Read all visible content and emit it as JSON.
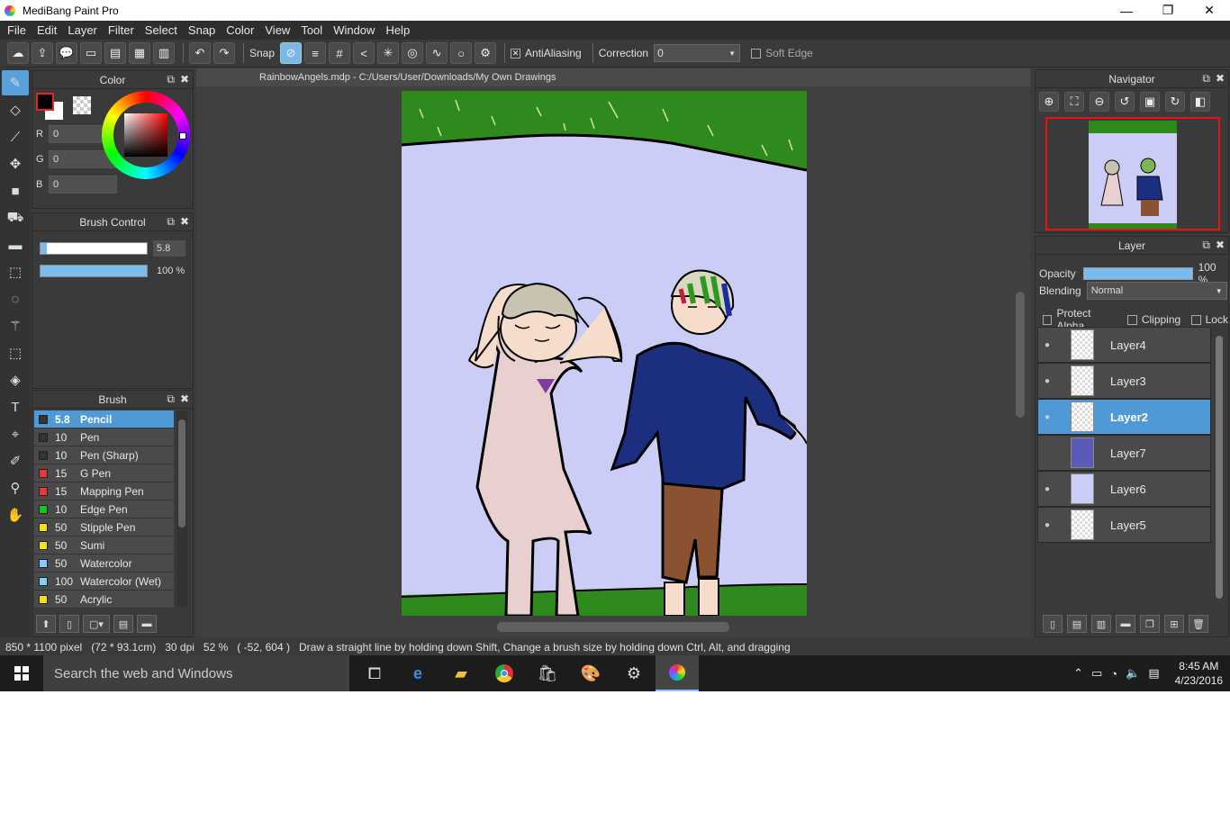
{
  "window": {
    "title": "MediBang Paint Pro",
    "min": "—",
    "max": "❐",
    "close": "✕"
  },
  "menu": [
    "File",
    "Edit",
    "Layer",
    "Filter",
    "Select",
    "Snap",
    "Color",
    "View",
    "Tool",
    "Window",
    "Help"
  ],
  "toolbar": {
    "snap_label": "Snap",
    "antialias_label": "AntiAliasing",
    "correction_label": "Correction",
    "correction_value": "0",
    "soft_edge_label": "Soft Edge"
  },
  "color_panel": {
    "title": "Color",
    "r_label": "R",
    "r": "0",
    "g_label": "G",
    "g": "0",
    "b_label": "B",
    "b": "0",
    "fg": "#000000",
    "bg": "#ffffff"
  },
  "brush_control": {
    "title": "Brush Control",
    "size": "5.8",
    "opacity": "100 %",
    "size_fraction": 0.058,
    "opacity_fraction": 1.0
  },
  "brush_panel": {
    "title": "Brush",
    "items": [
      {
        "size": "5.8",
        "name": "Pencil",
        "color": "#333333"
      },
      {
        "size": "10",
        "name": "Pen",
        "color": "#333333"
      },
      {
        "size": "10",
        "name": "Pen (Sharp)",
        "color": "#333333"
      },
      {
        "size": "15",
        "name": "G Pen",
        "color": "#e63a3a"
      },
      {
        "size": "15",
        "name": "Mapping Pen",
        "color": "#e63a3a"
      },
      {
        "size": "10",
        "name": "Edge Pen",
        "color": "#22bb22"
      },
      {
        "size": "50",
        "name": "Stipple Pen",
        "color": "#f0e020"
      },
      {
        "size": "50",
        "name": "Sumi",
        "color": "#f0e020"
      },
      {
        "size": "50",
        "name": "Watercolor",
        "color": "#7fd0f8"
      },
      {
        "size": "100",
        "name": "Watercolor (Wet)",
        "color": "#7fd0f8"
      },
      {
        "size": "50",
        "name": "Acrylic",
        "color": "#f0e020"
      }
    ]
  },
  "document": {
    "tab": "RainbowAngels.mdp - C:/Users/User/Downloads/My Own Drawings"
  },
  "navigator": {
    "title": "Navigator"
  },
  "layer_panel": {
    "title": "Layer",
    "opacity_label": "Opacity",
    "opacity": "100 %",
    "blending_label": "Blending",
    "blending": "Normal",
    "protect_alpha": "Protect Alpha",
    "clipping": "Clipping",
    "lock": "Lock",
    "layers": [
      {
        "name": "Layer4",
        "visible": true,
        "selected": false
      },
      {
        "name": "Layer3",
        "visible": true,
        "selected": false
      },
      {
        "name": "Layer2",
        "visible": true,
        "selected": true
      },
      {
        "name": "Layer7",
        "visible": false,
        "selected": false
      },
      {
        "name": "Layer6",
        "visible": true,
        "selected": false
      },
      {
        "name": "Layer5",
        "visible": true,
        "selected": false
      }
    ]
  },
  "status": {
    "size": "850 * 1100 pixel",
    "cm": "(72 * 93.1cm)",
    "dpi": "30 dpi",
    "zoom": "52 %",
    "coords": "( -52, 604 )",
    "hint": "Draw a straight line by holding down Shift, Change a brush size by holding down Ctrl, Alt, and dragging"
  },
  "taskbar": {
    "search_placeholder": "Search the web and Windows",
    "time": "8:45 AM",
    "date": "4/23/2016"
  }
}
